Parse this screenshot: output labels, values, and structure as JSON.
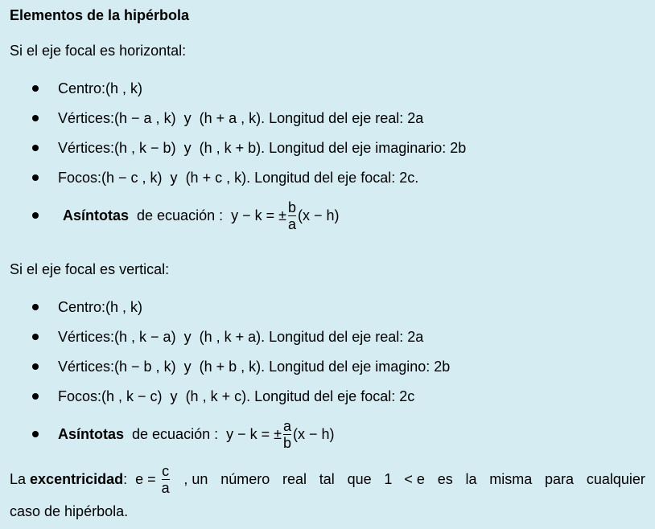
{
  "title": "Elementos de la hipérbola",
  "horizontal": {
    "intro": "Si el eje focal  es horizontal:",
    "centro_label": "Centro: ",
    "centro_math": "(h , k)",
    "vert1_label": "Vértices: ",
    "vert1_a": "(h − a , k)",
    "vert1_b": "(h + a , k)",
    "vert1_text": ". Longitud del eje real: 2a",
    "vert2_label": "Vértices: ",
    "vert2_a": "(h , k − b)",
    "vert2_b": "(h , k + b)",
    "vert2_text": ". Longitud del eje imaginario: 2b",
    "focos_label": "Focos: ",
    "focos_a": "(h − c , k)",
    "focos_b": "(h + c , k)",
    "focos_text": ". Longitud del eje focal: 2c.",
    "asint_bold": "Asíntotas",
    "asint_text": "  de ecuación :  ",
    "asint_lhs": "y − k = ±",
    "asint_num": "b",
    "asint_den": "a",
    "asint_rhs": "(x − h)"
  },
  "vertical": {
    "intro": "Si el eje focal es vertical:",
    "centro_label": "Centro: ",
    "centro_math": "(h , k)",
    "vert1_label": "Vértices: ",
    "vert1_a": "(h , k − a)",
    "vert1_b": "(h , k + a)",
    "vert1_text": ". Longitud del eje real: 2a",
    "vert2_label": "Vértices: ",
    "vert2_a": "(h − b , k)",
    "vert2_b": "(h + b , k)",
    "vert2_text": ". Longitud del eje imagino: 2b",
    "focos_label": "Focos: ",
    "focos_a": "(h , k − c)",
    "focos_b": "(h , k + c)",
    "focos_text": ". Longitud del eje focal: 2c",
    "asint_bold": "Asíntotas",
    "asint_text": "  de ecuación :  ",
    "asint_lhs": "y − k = ±",
    "asint_num": "a",
    "asint_den": "b",
    "asint_rhs": "(x − h)"
  },
  "connector": "  y  ",
  "exc": {
    "pre": "La ",
    "bold": "excentricidad",
    "colon": ":  e = ",
    "num": "c",
    "den": "a",
    "w1": ", un",
    "w2": "número",
    "w3": "real",
    "w4": "tal",
    "w5": "que",
    "w6": "1   < e",
    "w7": "es",
    "w8": "la",
    "w9": "misma",
    "w10": "para",
    "w11": "cualquier",
    "line2": "caso de hipérbola."
  }
}
